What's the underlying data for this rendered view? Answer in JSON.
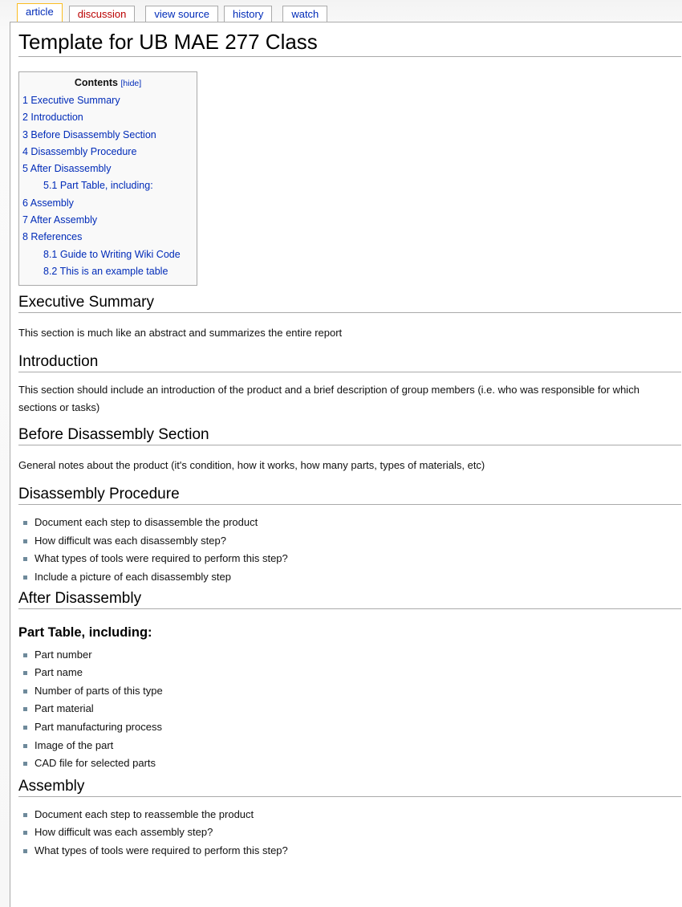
{
  "tabs": [
    {
      "label": "article",
      "state": "selected"
    },
    {
      "label": "discussion",
      "state": "new"
    },
    {
      "label": "view source",
      "state": "normal"
    },
    {
      "label": "history",
      "state": "normal"
    },
    {
      "label": "watch",
      "state": "normal"
    }
  ],
  "page_title": "Template for UB MAE 277 Class",
  "toc": {
    "title": "Contents",
    "hide_label": "[hide]",
    "items": [
      {
        "label": "1 Executive Summary",
        "level": 1
      },
      {
        "label": "2 Introduction",
        "level": 1
      },
      {
        "label": "3 Before Disassembly Section",
        "level": 1
      },
      {
        "label": "4 Disassembly Procedure",
        "level": 1
      },
      {
        "label": "5 After Disassembly",
        "level": 1
      },
      {
        "label": "5.1 Part Table, including:",
        "level": 2
      },
      {
        "label": "6 Assembly",
        "level": 1
      },
      {
        "label": "7 After Assembly",
        "level": 1
      },
      {
        "label": "8 References",
        "level": 1
      },
      {
        "label": "8.1 Guide to Writing Wiki Code",
        "level": 2
      },
      {
        "label": "8.2 This is an example table",
        "level": 2
      }
    ]
  },
  "sections": {
    "executive_summary": {
      "heading": "Executive Summary",
      "text": "This section is much like an abstract and summarizes the entire report"
    },
    "introduction": {
      "heading": "Introduction",
      "text": "This section should include an introduction of the product and a brief description of group members (i.e. who was responsible for which sections or tasks)"
    },
    "before_disassembly": {
      "heading": "Before Disassembly Section",
      "text": "General notes about the product (it's condition, how it works, how many parts, types of materials, etc)"
    },
    "disassembly_procedure": {
      "heading": "Disassembly Procedure",
      "items": [
        "Document each step to disassemble the product",
        "How difficult was each disassembly step?",
        "What types of tools were required to perform this step?",
        "Include a picture of each disassembly step"
      ]
    },
    "after_disassembly": {
      "heading": "After Disassembly",
      "subheading": "Part Table, including:",
      "items": [
        "Part number",
        "Part name",
        "Number of parts of this type",
        "Part material",
        "Part manufacturing process",
        "Image of the part",
        "CAD file for selected parts"
      ]
    },
    "assembly": {
      "heading": "Assembly",
      "items": [
        "Document each step to reassemble the product",
        "How difficult was each assembly step?",
        "What types of tools were required to perform this step?"
      ]
    }
  }
}
